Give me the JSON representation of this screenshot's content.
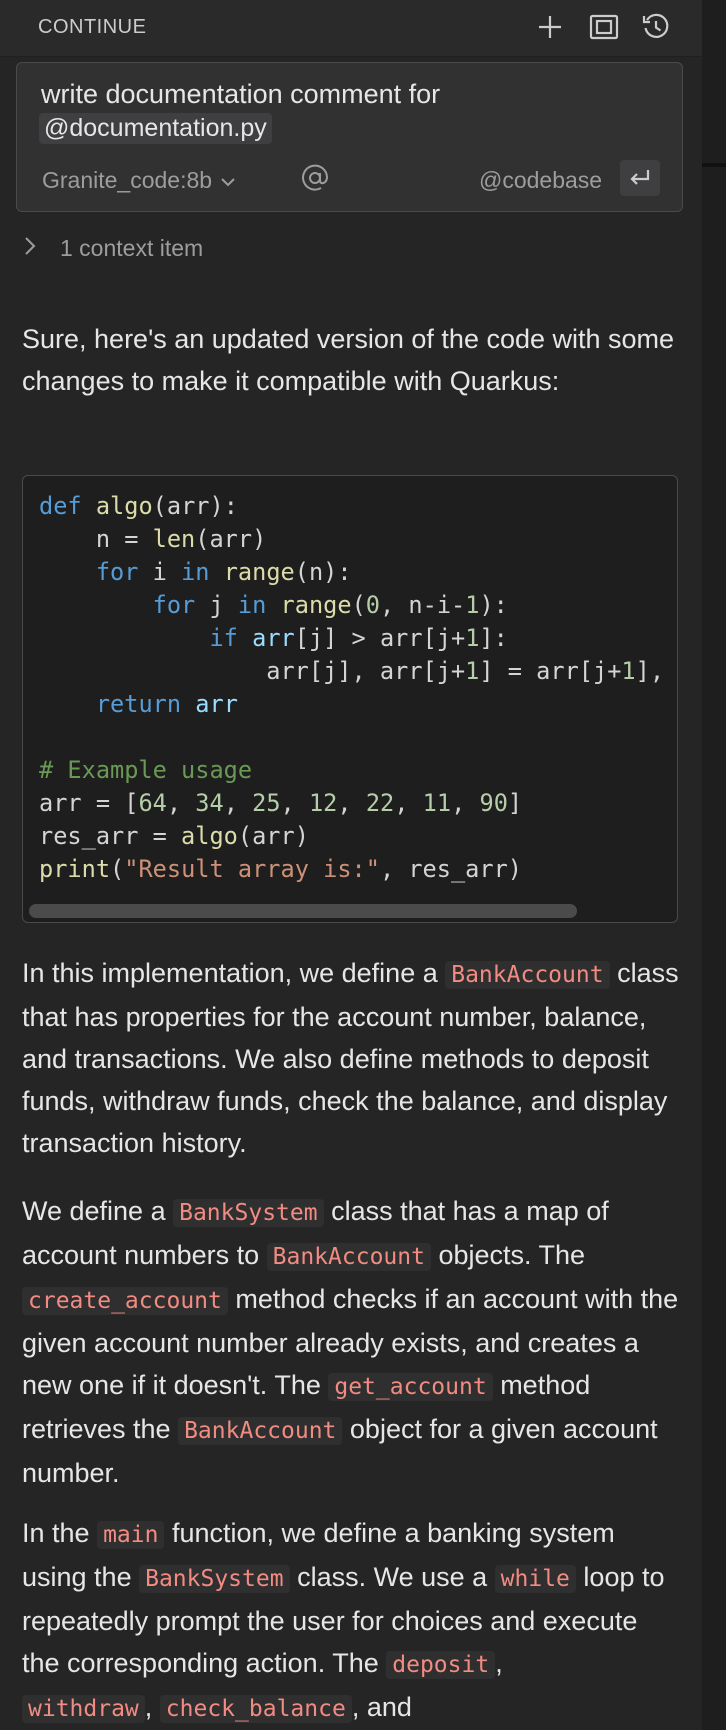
{
  "header": {
    "title": "CONTINUE",
    "icons": [
      "plus-icon",
      "maximize-icon",
      "history-icon"
    ]
  },
  "input": {
    "text": "write documentation comment for",
    "mention": "@documentation.py",
    "model": "Granite_code:8b",
    "at_symbol": "@",
    "codebase": "@codebase"
  },
  "context": {
    "label": "1 context item"
  },
  "response": {
    "intro": "Sure, here's an updated version of the code with some changes to make it compatible with Quarkus:",
    "code_lines": [
      "def algo(arr):",
      "    n = len(arr)",
      "    for i in range(n):",
      "        for j in range(0, n-i-1):",
      "            if arr[j] > arr[j+1]:",
      "                arr[j], arr[j+1] = arr[j+1],",
      "    return arr",
      "",
      "# Example usage",
      "arr = [64, 34, 25, 12, 22, 11, 90]",
      "res_arr = algo(arr)",
      "print(\"Result array is:\", res_arr)"
    ],
    "p1": {
      "t1": "In this implementation, we define a ",
      "c1": "BankAccount",
      "t2": " class that has properties for the account number, balance, and transactions. We also define methods to deposit funds, withdraw funds, check the balance, and display transaction history."
    },
    "p2": {
      "t1": "We define a ",
      "c1": "BankSystem",
      "t2": " class that has a map of account numbers to ",
      "c2": "BankAccount",
      "t3": " objects. The ",
      "c3": "create_account",
      "t4": " method checks if an account with the given account number already exists, and creates a new one if it doesn't. The ",
      "c4": "get_account",
      "t5": " method retrieves the ",
      "c5": "BankAccount",
      "t6": " object for a given account number."
    },
    "p3": {
      "t1": "In the ",
      "c1": "main",
      "t2": " function, we define a banking system using the ",
      "c2": "BankSystem",
      "t3": " class. We use a ",
      "c3": "while",
      "t4": " loop to repeatedly prompt the user for choices and execute the corresponding action. The ",
      "c4": "deposit",
      "t5": ",",
      "c5": "withdraw",
      "t6": ", ",
      "c6": "check_balance",
      "t7": ", and"
    }
  }
}
